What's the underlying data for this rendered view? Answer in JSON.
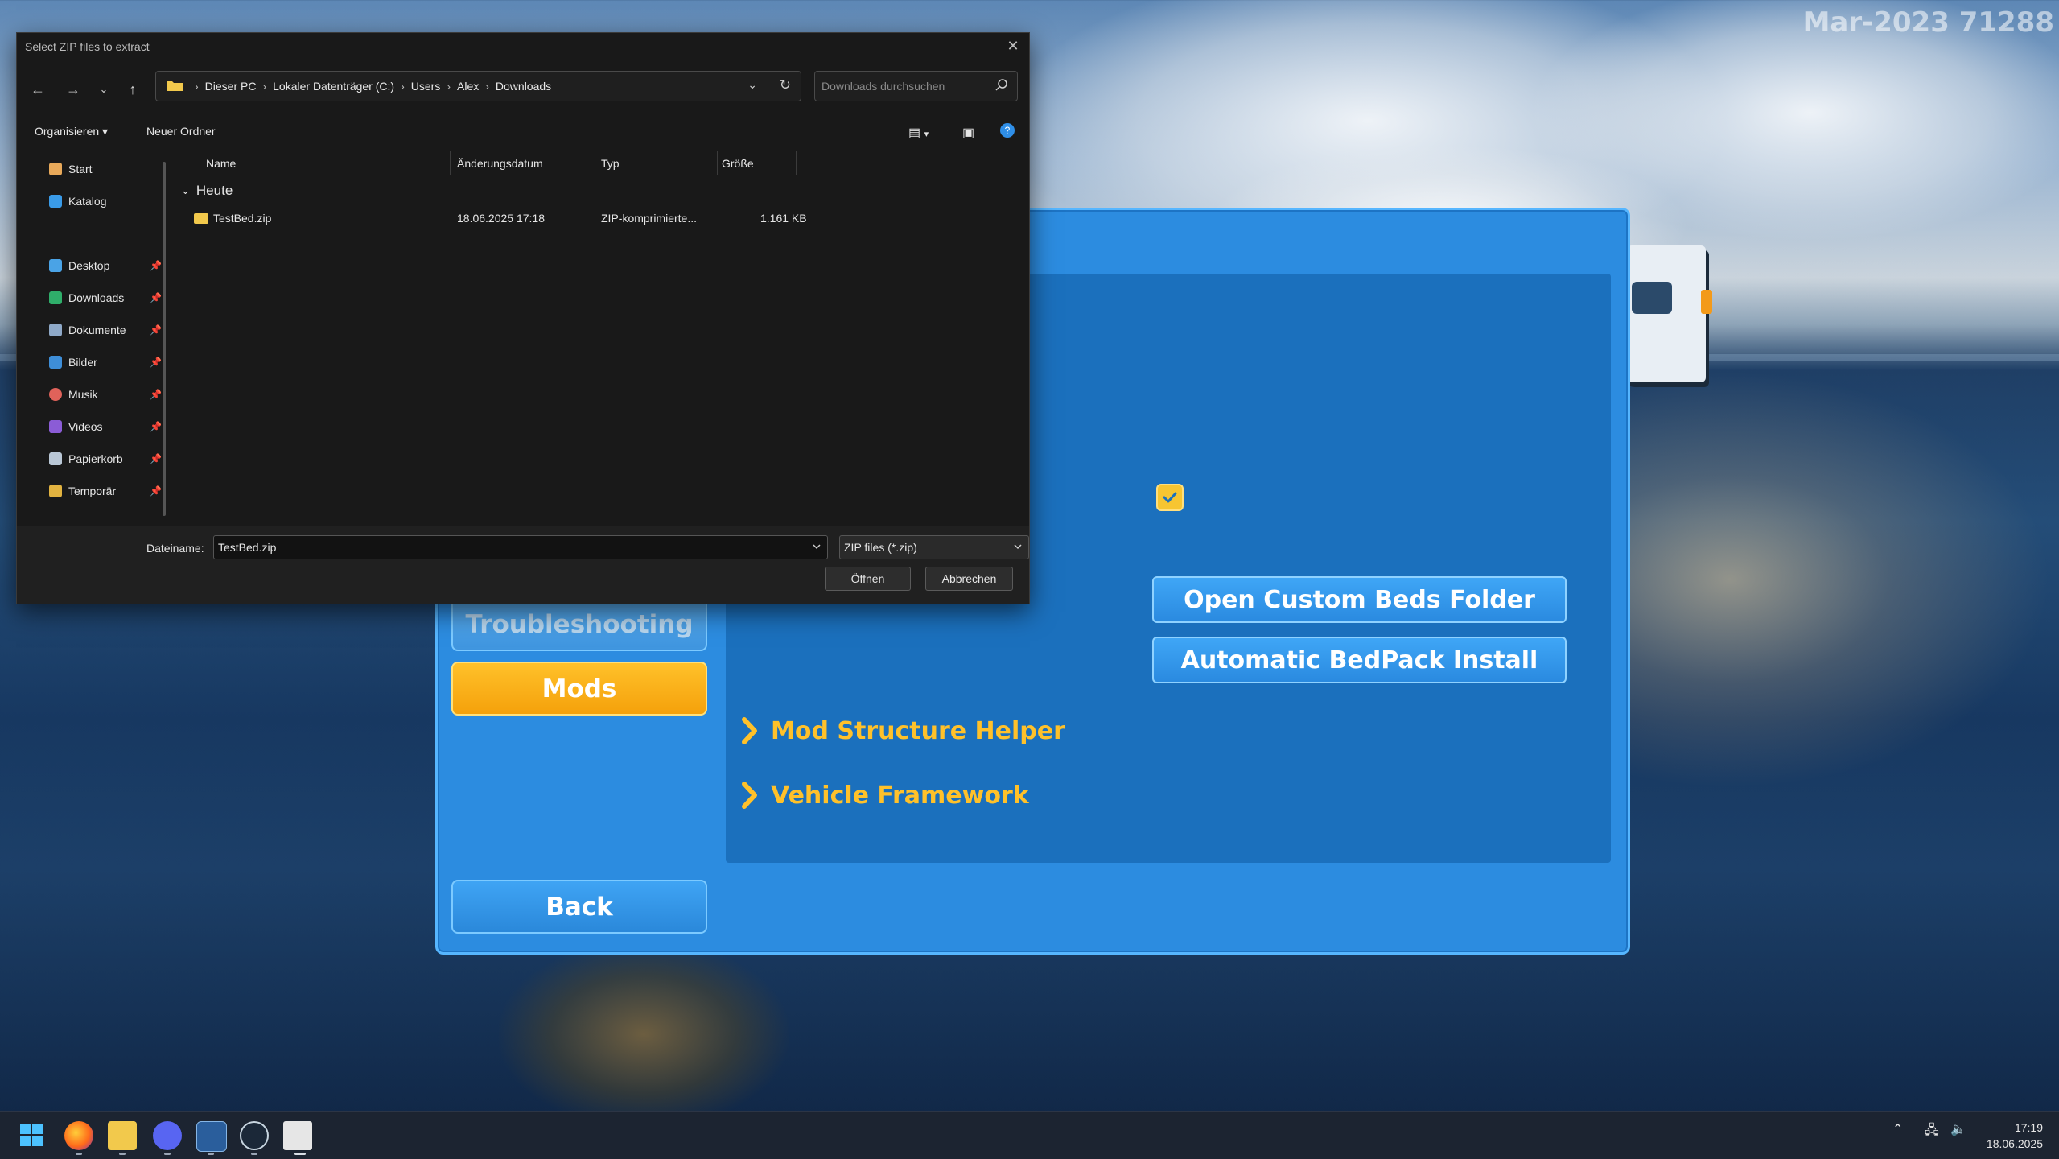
{
  "watermark": "Mar-2023 71288",
  "dialog": {
    "title": "Select ZIP files to extract",
    "breadcrumbs": [
      "Dieser PC",
      "Lokaler Datenträger (C:)",
      "Users",
      "Alex",
      "Downloads"
    ],
    "search_placeholder": "Downloads durchsuchen",
    "toolbar": {
      "organize": "Organisieren",
      "new_folder": "Neuer Ordner"
    },
    "nav_items": [
      {
        "label": "Start",
        "icon": "home-icon"
      },
      {
        "label": "Katalog",
        "icon": "gallery-icon"
      },
      {
        "label": "Desktop",
        "icon": "desktop-icon"
      },
      {
        "label": "Downloads",
        "icon": "download-icon"
      },
      {
        "label": "Dokumente",
        "icon": "document-icon"
      },
      {
        "label": "Bilder",
        "icon": "pictures-icon"
      },
      {
        "label": "Musik",
        "icon": "music-icon"
      },
      {
        "label": "Videos",
        "icon": "videos-icon"
      },
      {
        "label": "Papierkorb",
        "icon": "recycle-bin-icon"
      },
      {
        "label": "Temporär",
        "icon": "folder-icon"
      }
    ],
    "columns": [
      "Name",
      "Änderungsdatum",
      "Typ",
      "Größe"
    ],
    "group": "Heute",
    "files": [
      {
        "name": "TestBed.zip",
        "date": "18.06.2025 17:18",
        "type": "ZIP-komprimierte...",
        "size": "1.161 KB"
      }
    ],
    "filename_label": "Dateiname:",
    "filename_value": "TestBed.zip",
    "filetype": "ZIP files (*.zip)",
    "open_label": "Öffnen",
    "cancel_label": "Abbrechen"
  },
  "game": {
    "sidebar": {
      "troubleshooting": "Troubleshooting",
      "mods": "Mods",
      "back": "Back"
    },
    "buttons": {
      "open_folder": "Open Custom Beds Folder",
      "auto_install": "Automatic BedPack Install"
    },
    "links": [
      "Mod Structure Helper",
      "Vehicle Framework"
    ],
    "checkbox_checked": true,
    "accent": "#ffc12a"
  },
  "taskbar": {
    "time": "17:19",
    "date": "18.06.2025"
  }
}
